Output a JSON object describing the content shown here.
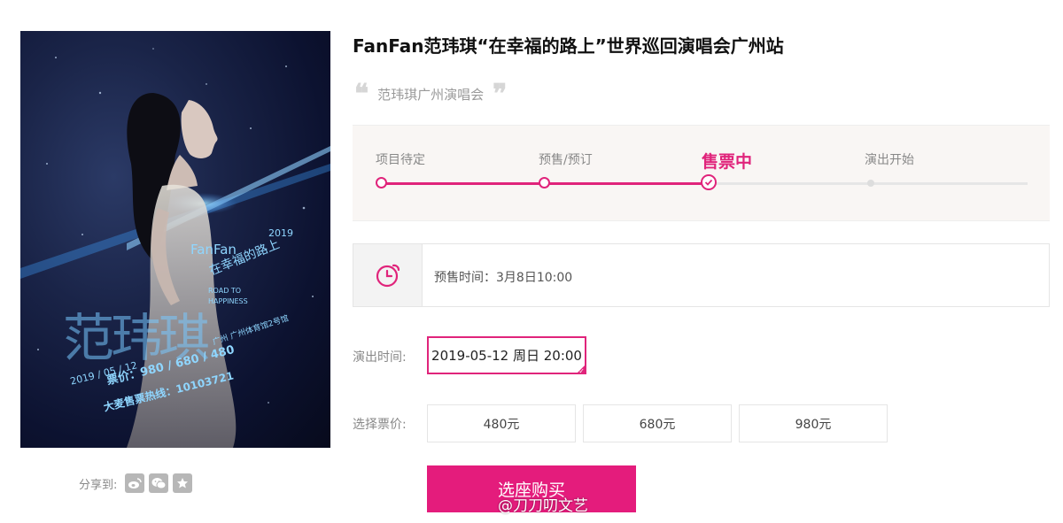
{
  "title": "FanFan范玮琪“在幸福的路上”世界巡回演唱会广州站",
  "subtitle": "范玮琪广州演唱会",
  "quote_open": "❝",
  "quote_close": "❞",
  "poster": {
    "name": "范玮琪",
    "fanfan": "FanFan",
    "year": "2019",
    "tour_title": "在幸福的路上",
    "road": "ROAD TO HAPPINESS",
    "city": "广州",
    "venue": "广州体育馆2号馆",
    "date": "2019 / 05 / 12",
    "price_line": "票价：980 / 680 / 480",
    "hotline_line": "大麦售票热线：10103721"
  },
  "share": {
    "label": "分享到:",
    "icons": [
      "weibo-icon",
      "wechat-icon",
      "favorite-star-icon"
    ]
  },
  "steps": {
    "items": [
      {
        "label": "项目待定",
        "state": "done"
      },
      {
        "label": "预售/预订",
        "state": "done"
      },
      {
        "label": "售票中",
        "state": "current"
      },
      {
        "label": "演出开始",
        "state": "pending"
      }
    ],
    "accent_color": "#e0247b"
  },
  "presale": {
    "text": "预售时间：3月8日10:00",
    "icon": "clock-icon"
  },
  "showtime": {
    "label": "演出时间:",
    "option": "2019-05-12 周日 20:00",
    "selected": true
  },
  "prices": {
    "label": "选择票价:",
    "options": [
      "480元",
      "680元",
      "980元"
    ]
  },
  "buy_button": "选座购买",
  "watermark": "@刀刀叨文艺"
}
